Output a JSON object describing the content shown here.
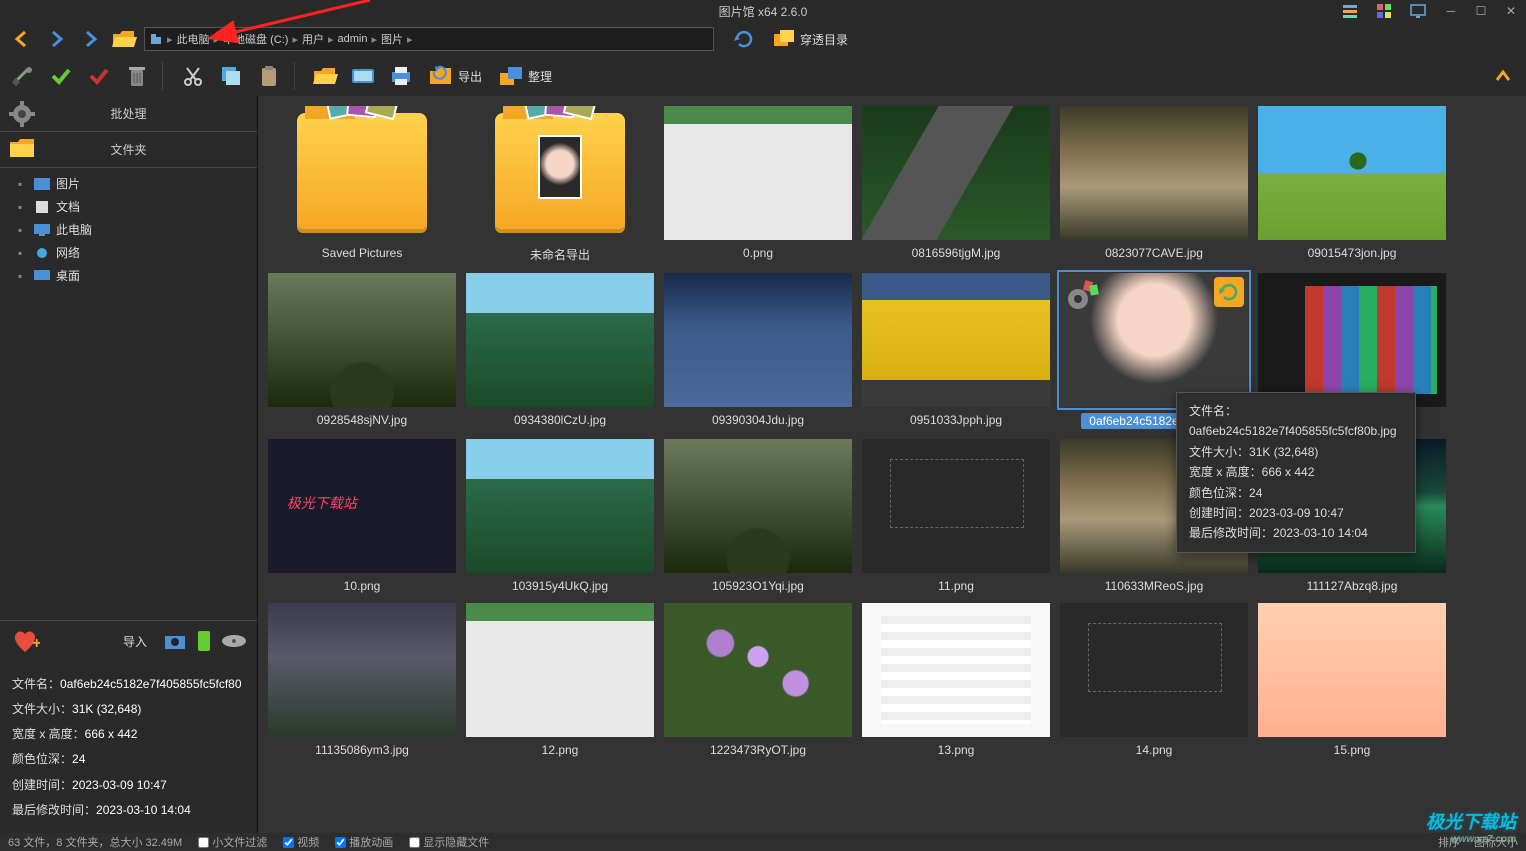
{
  "app": {
    "title": "图片馆 x64 2.6.0"
  },
  "breadcrumb": [
    "此电脑",
    "本地磁盘 (C:)",
    "用户",
    "admin",
    "图片"
  ],
  "nav": {
    "penetrate_label": "穿透目录"
  },
  "toolbar": {
    "export_label": "导出",
    "organize_label": "整理"
  },
  "sidebar": {
    "tab_batch": "批处理",
    "tab_folder": "文件夹",
    "tree": [
      {
        "label": "图片"
      },
      {
        "label": "文档"
      },
      {
        "label": "此电脑"
      },
      {
        "label": "网络"
      },
      {
        "label": "桌面"
      }
    ],
    "import_label": "导入"
  },
  "info_panel": {
    "filename_label": "文件名：",
    "filename": "0af6eb24c5182e7f405855fc5fcf80",
    "filesize_label": "文件大小：",
    "filesize": "31K (32,648)",
    "dimensions_label": "宽度 x 高度：",
    "dimensions": "666 x 442",
    "depth_label": "颜色位深：",
    "depth": "24",
    "created_label": "创建时间：",
    "created": "2023-03-09 10:47",
    "modified_label": "最后修改时间：",
    "modified": "2023-03-10 14:04"
  },
  "thumbs": [
    {
      "label": "Saved Pictures",
      "type": "folder"
    },
    {
      "label": "未命名导出",
      "type": "folder-portrait"
    },
    {
      "label": "0.png",
      "type": "screenshot"
    },
    {
      "label": "0816596tjgM.jpg",
      "type": "road"
    },
    {
      "label": "0823077CAVE.jpg",
      "type": "castle"
    },
    {
      "label": "09015473jon.jpg",
      "type": "field"
    },
    {
      "label": "0928548sjNV.jpg",
      "type": "landscape1"
    },
    {
      "label": "0934380lCzU.jpg",
      "type": "landscape2"
    },
    {
      "label": "09390304Jdu.jpg",
      "type": "landscape3"
    },
    {
      "label": "0951033Jpph.jpg",
      "type": "yellow-bldg"
    },
    {
      "label": "0af6eb24c5182e7f405...",
      "type": "face2",
      "selected": true
    },
    {
      "label": "",
      "type": "tiles"
    },
    {
      "label": "10.png",
      "type": "dark-code"
    },
    {
      "label": "103915y4UkQ.jpg",
      "type": "landscape2"
    },
    {
      "label": "105923O1Yqi.jpg",
      "type": "landscape1"
    },
    {
      "label": "11.png",
      "type": "darkui"
    },
    {
      "label": "110633MReoS.jpg",
      "type": "castle"
    },
    {
      "label": "111127Abzq8.jpg",
      "type": "aurora"
    },
    {
      "label": "11135086ym3.jpg",
      "type": "stormy"
    },
    {
      "label": "12.png",
      "type": "screenshot"
    },
    {
      "label": "1223473RyOT.jpg",
      "type": "flowers"
    },
    {
      "label": "13.png",
      "type": "whiteui"
    },
    {
      "label": "14.png",
      "type": "darkui"
    },
    {
      "label": "15.png",
      "type": "peach"
    }
  ],
  "tooltip": {
    "filename_label": "文件名：",
    "filename": "0af6eb24c5182e7f405855fc5fcf80b.jpg",
    "filesize_label": "文件大小：",
    "filesize": "31K (32,648)",
    "dimensions_label": "宽度 x 高度：",
    "dimensions": "666 x 442",
    "depth_label": "颜色位深：",
    "depth": "24",
    "created_label": "创建时间：",
    "created": "2023-03-09 10:47",
    "modified_label": "最后修改时间：",
    "modified": "2023-03-10 14:04"
  },
  "status": {
    "summary": "63 文件，8 文件夹，总大小 32.49M",
    "chk_casefilter": "小文件过滤",
    "chk_video": "视频",
    "chk_anim": "播放动画",
    "chk_hidden": "显示隐藏文件",
    "sort_label": "排序",
    "iconsize_label": "图标大小"
  },
  "watermark": {
    "brand": "极光下载站",
    "url": "www.xz7.com"
  }
}
